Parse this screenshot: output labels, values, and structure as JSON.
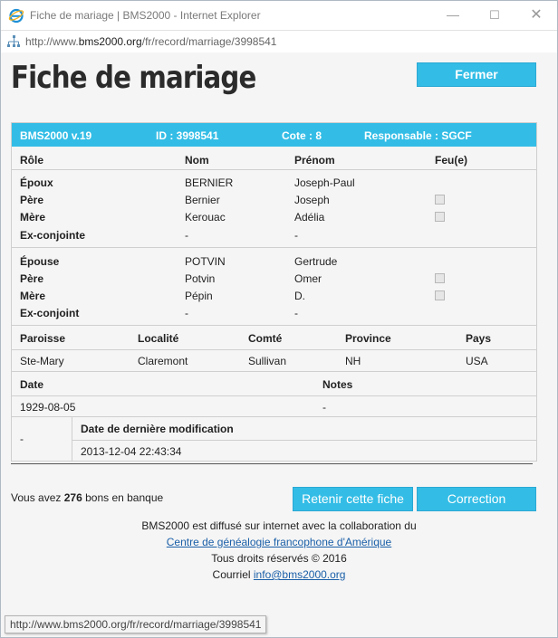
{
  "window": {
    "title": "Fiche de mariage | BMS2000 - Internet Explorer",
    "url_prefix": "http://www.",
    "url_domain": "bms2000.org",
    "url_path": "/fr/record/marriage/3998541",
    "status_url": "http://www.bms2000.org/fr/record/marriage/3998541"
  },
  "page": {
    "title": "Fiche de mariage",
    "close_label": "Fermer"
  },
  "record_header": {
    "version": "BMS2000 v.19",
    "id": "ID : 3998541",
    "cote": "Cote : 8",
    "responsable": "Responsable : SGCF"
  },
  "columns": {
    "role": "Rôle",
    "nom": "Nom",
    "prenom": "Prénom",
    "feu": "Feu(e)"
  },
  "groom": [
    {
      "role": "Époux",
      "nom": "BERNIER",
      "prenom": "Joseph-Paul"
    },
    {
      "role": "Père",
      "nom": "Bernier",
      "prenom": "Joseph"
    },
    {
      "role": "Mère",
      "nom": "Kerouac",
      "prenom": "Adélia"
    },
    {
      "role": "Ex-conjointe",
      "nom": "-",
      "prenom": "-"
    }
  ],
  "bride": [
    {
      "role": "Épouse",
      "nom": "POTVIN",
      "prenom": "Gertrude"
    },
    {
      "role": "Père",
      "nom": "Potvin",
      "prenom": "Omer"
    },
    {
      "role": "Mère",
      "nom": "Pépin",
      "prenom": "D."
    },
    {
      "role": "Ex-conjoint",
      "nom": "-",
      "prenom": "-"
    }
  ],
  "location": {
    "headers": {
      "paroisse": "Paroisse",
      "localite": "Localité",
      "comte": "Comté",
      "province": "Province",
      "pays": "Pays"
    },
    "values": {
      "paroisse": "Ste-Mary",
      "localite": "Claremont",
      "comte": "Sullivan",
      "province": "NH",
      "pays": "USA"
    }
  },
  "dates": {
    "date_label": "Date",
    "notes_label": "Notes",
    "date_value": "1929-08-05",
    "notes_value": "-"
  },
  "modification": {
    "left_value": "-",
    "label": "Date de dernière modification",
    "value": "2013-12-04 22:43:34"
  },
  "bank": {
    "prefix": "Vous avez",
    "count": "276",
    "suffix": "bons en banque"
  },
  "actions": {
    "retain_label": "Retenir cette fiche",
    "correction_label": "Correction"
  },
  "footer": {
    "line1": "BMS2000 est diffusé sur internet avec la collaboration du",
    "partner_link": "Centre de généalogie francophone d'Amérique",
    "rights": "Tous droits réservés © 2016",
    "courriel_label": "Courriel",
    "email": "info@bms2000.org"
  },
  "colors": {
    "accent": "#33bde6",
    "link": "#1a5fa8",
    "title": "#2b2b2b"
  },
  "icons": [
    "ie-logo-icon",
    "minimize-icon",
    "maximize-icon",
    "close-icon",
    "site-tree-icon"
  ]
}
